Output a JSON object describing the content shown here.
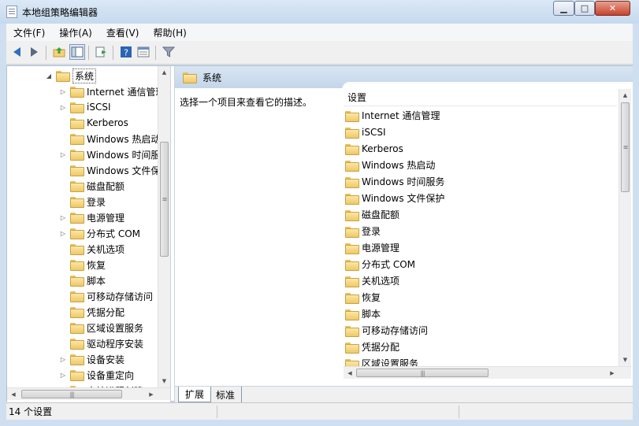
{
  "window": {
    "title": "本地组策略编辑器"
  },
  "menu": [
    "文件(F)",
    "操作(A)",
    "查看(V)",
    "帮助(H)"
  ],
  "tree": {
    "root": "系统",
    "items": [
      {
        "label": "Internet 通信管理",
        "expandable": true
      },
      {
        "label": "iSCSI",
        "expandable": true
      },
      {
        "label": "Kerberos",
        "expandable": false
      },
      {
        "label": "Windows 热启动",
        "expandable": false
      },
      {
        "label": "Windows 时间服务",
        "expandable": true
      },
      {
        "label": "Windows 文件保护",
        "expandable": false
      },
      {
        "label": "磁盘配额",
        "expandable": false
      },
      {
        "label": "登录",
        "expandable": false
      },
      {
        "label": "电源管理",
        "expandable": true
      },
      {
        "label": "分布式 COM",
        "expandable": true
      },
      {
        "label": "关机选项",
        "expandable": false
      },
      {
        "label": "恢复",
        "expandable": false
      },
      {
        "label": "脚本",
        "expandable": false
      },
      {
        "label": "可移动存储访问",
        "expandable": false
      },
      {
        "label": "凭据分配",
        "expandable": false
      },
      {
        "label": "区域设置服务",
        "expandable": false
      },
      {
        "label": "驱动程序安装",
        "expandable": false
      },
      {
        "label": "设备安装",
        "expandable": true
      },
      {
        "label": "设备重定向",
        "expandable": true
      },
      {
        "label": "审核进程创建",
        "expandable": false
      }
    ]
  },
  "content": {
    "header": "系统",
    "description": "选择一个项目来查看它的描述。",
    "list_header": "设置",
    "items": [
      "Internet 通信管理",
      "iSCSI",
      "Kerberos",
      "Windows 热启动",
      "Windows 时间服务",
      "Windows 文件保护",
      "磁盘配额",
      "登录",
      "电源管理",
      "分布式 COM",
      "关机选项",
      "恢复",
      "脚本",
      "可移动存储访问",
      "凭据分配",
      "区域设置服务"
    ]
  },
  "tabs": {
    "active": "扩展",
    "inactive": "标准"
  },
  "status": {
    "text": "14 个设置"
  }
}
